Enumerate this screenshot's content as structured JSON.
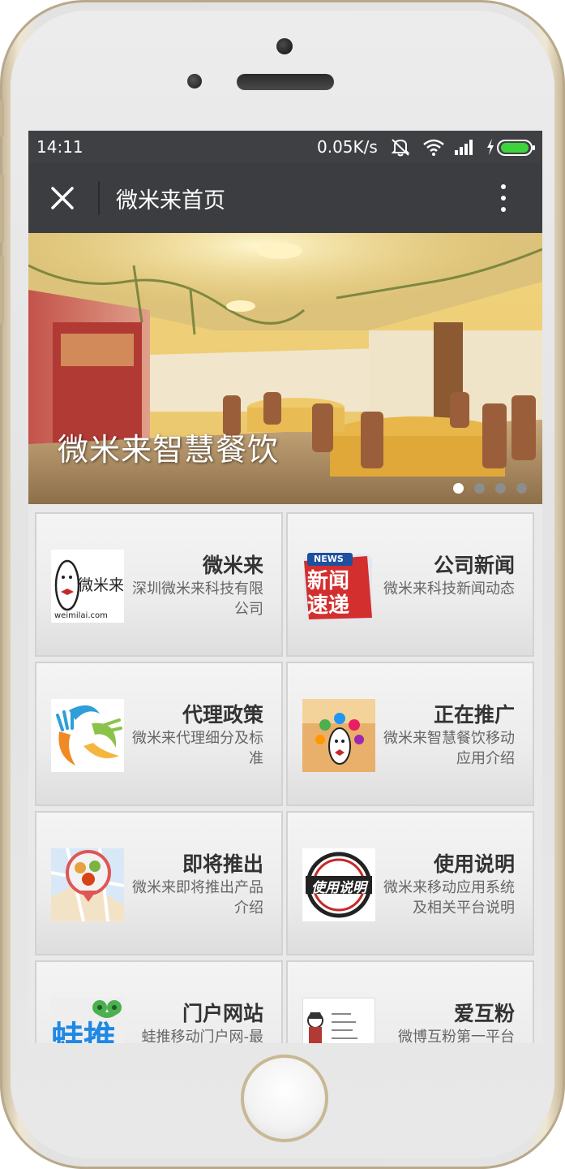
{
  "status_bar": {
    "time": "14:11",
    "network_speed": "0.05K/s",
    "icons": [
      "mute-icon",
      "wifi-icon",
      "signal-icon",
      "charging-icon",
      "battery-icon"
    ]
  },
  "nav_bar": {
    "close_icon": "close-icon",
    "title": "微米来首页",
    "menu_icon": "more-vertical-icon"
  },
  "banner": {
    "caption": "微米来智慧餐饮",
    "slide_count": 4,
    "active_slide": 1
  },
  "tiles": [
    {
      "title": "微米来",
      "desc": "深圳微米来科技有限公司",
      "logo_text": "weimilai.com",
      "icon": "weimilai-logo-icon"
    },
    {
      "title": "公司新闻",
      "desc": "微米来科技新闻动态",
      "logo_badge": "NEWS",
      "logo_text": "新闻速递",
      "icon": "news-icon"
    },
    {
      "title": "代理政策",
      "desc": "微米来代理细分及标准",
      "icon": "hands-icon"
    },
    {
      "title": "正在推广",
      "desc": "微米来智慧餐饮移动应用介绍",
      "icon": "promotion-icon"
    },
    {
      "title": "即将推出",
      "desc": "微米来即将推出产品介绍",
      "icon": "map-pin-food-icon"
    },
    {
      "title": "使用说明",
      "desc": "微米来移动应用系统及相关平台说明",
      "logo_text": "使用说明",
      "icon": "manual-stamp-icon"
    },
    {
      "title": "门户网站",
      "desc": "蛙推移动门户网-最",
      "logo_text": "蛙推",
      "icon": "frog-logo-icon"
    },
    {
      "title": "爱互粉",
      "desc": "微博互粉第一平台",
      "icon": "aihufen-icon"
    }
  ],
  "colors": {
    "status_bar": "#3f4043",
    "nav_bar": "#3c3d40",
    "tile_bg": "#eeeeee",
    "title_text": "#333333",
    "desc_text": "#666666"
  }
}
